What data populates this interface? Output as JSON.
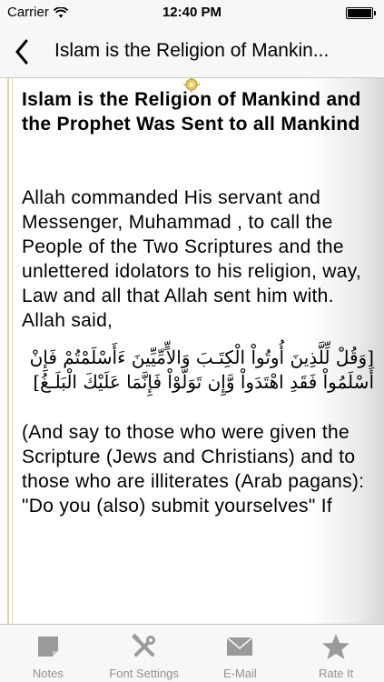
{
  "status_bar": {
    "carrier": "Carrier",
    "time": "12:40 PM",
    "battery_level": 1.0
  },
  "nav": {
    "title": "Islam is the Religion of Mankin...",
    "back_icon": "chevron-left-icon"
  },
  "content": {
    "heading": "Islam is the Religion of Mankind and the Prophet Was Sent to all Mankind",
    "paragraph_1": "Allah commanded His servant and Messenger, Muhammad , to call the People of the Two Scriptures and the unlettered idolators to his religion, way, Law and all that Allah sent him with. Allah said,",
    "arabic_verse": "[وَقُلْ لِّلَّذِينَ أُوتُواْ الْكِتَـبَ وَالاٍّمِّيِّينَ ءَأَسْلَمْتُمْ فَإِنْ أَسْلَمُواْ فَقَدِ اهْتَدَواْ وَّإِن تَوَلَّوْاْ فَإِنَّمَا عَلَيْكَ الْبَلَـغُ]",
    "paragraph_2": "(And say to those who were given the Scripture (Jews and Christians) and to those who are illiterates (Arab pagans): \"Do you (also) submit yourselves\" If"
  },
  "tabs": [
    {
      "label": "Notes",
      "icon": "notes-icon"
    },
    {
      "label": "Font Settings",
      "icon": "tools-icon"
    },
    {
      "label": "E-Mail",
      "icon": "envelope-icon"
    },
    {
      "label": "Rate It",
      "icon": "star-icon"
    }
  ],
  "colors": {
    "bar_background": "#f7f7f7",
    "tab_icon": "#9a9a9a",
    "page_rule": "#e6cfa0"
  }
}
